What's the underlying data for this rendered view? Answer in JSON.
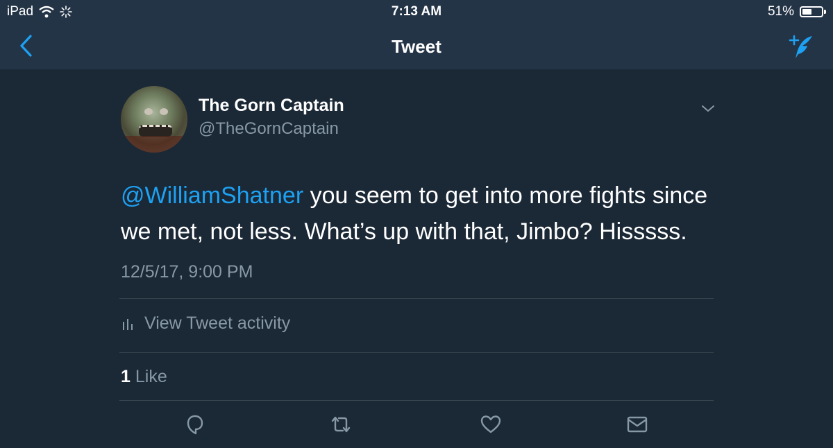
{
  "status_bar": {
    "device": "iPad",
    "time": "7:13 AM",
    "battery": "51%",
    "battery_level": 0.51
  },
  "nav": {
    "title": "Tweet",
    "icons": {
      "back": "chevron-left-icon",
      "compose": "compose-tweet-icon"
    }
  },
  "tweet": {
    "author_name": "The Gorn Captain",
    "author_handle": "@TheGornCaptain",
    "mention": "@WilliamShatner",
    "body": " you seem to get into more fights since we met, not less. What’s up with that, Jimbo? Hisssss.",
    "timestamp": "12/5/17, 9:00 PM",
    "activity_label": "View Tweet activity",
    "like_count": "1",
    "like_label": "Like"
  },
  "actions": [
    "reply-icon",
    "retweet-icon",
    "like-icon",
    "direct-message-icon"
  ],
  "colors": {
    "background": "#1b2836",
    "bar": "#243447",
    "accent": "#1da1f2",
    "secondary_text": "#8899a6",
    "divider": "#38444d"
  }
}
